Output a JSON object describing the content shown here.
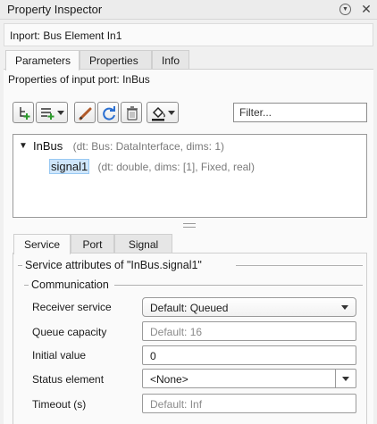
{
  "window": {
    "title": "Property Inspector",
    "menu_icon": "circle-chevron-down-icon",
    "close_icon": "close-icon",
    "close_glyph": "✕",
    "menu_glyph": "▼"
  },
  "header": {
    "block_title": "Inport: Bus Element In1"
  },
  "tabs": [
    {
      "label": "Parameters",
      "active": true
    },
    {
      "label": "Properties",
      "active": false
    },
    {
      "label": "Info",
      "active": false
    }
  ],
  "parameters": {
    "section_label": "Properties of input port: InBus",
    "toolbar": {
      "buttons": [
        {
          "name": "add-element-button",
          "icon": "add-element-icon"
        },
        {
          "name": "add-menu-button",
          "icon": "add-list-icon",
          "has_menu": true
        },
        {
          "name": "edit-button",
          "icon": "pencil-icon"
        },
        {
          "name": "refresh-button",
          "icon": "refresh-icon"
        },
        {
          "name": "delete-button",
          "icon": "trash-icon"
        },
        {
          "name": "highlight-button",
          "icon": "paint-bucket-icon",
          "has_menu": true
        }
      ],
      "filter_placeholder": "Filter..."
    },
    "tree": {
      "root": {
        "expander": "▼",
        "name": "InBus",
        "meta": "(dt: Bus: DataInterface, dims: 1)"
      },
      "children": [
        {
          "name": "signal1",
          "meta": "(dt: double, dims: [1], Fixed, real)",
          "selected": true
        }
      ]
    },
    "subtabs": [
      {
        "label": "Service",
        "active": true
      },
      {
        "label": "Port",
        "active": false
      },
      {
        "label": "Signal",
        "active": false
      }
    ],
    "service": {
      "group_title": "Service attributes of \"InBus.signal1\"",
      "subgroup_title": "Communication",
      "fields": {
        "receiver_service": {
          "label": "Receiver service",
          "value": "Default: Queued"
        },
        "queue_capacity": {
          "label": "Queue capacity",
          "placeholder": "Default: 16",
          "value": ""
        },
        "initial_value": {
          "label": "Initial value",
          "value": "0"
        },
        "status_element": {
          "label": "Status element",
          "value": "<None>"
        },
        "timeout": {
          "label": "Timeout (s)",
          "placeholder": "Default: Inf",
          "value": ""
        }
      }
    }
  },
  "colors": {
    "selection": "#cfe6fb",
    "delete_red": "#c0392b",
    "add_green": "#2e9b2e",
    "refresh_blue": "#2a6fd1"
  }
}
